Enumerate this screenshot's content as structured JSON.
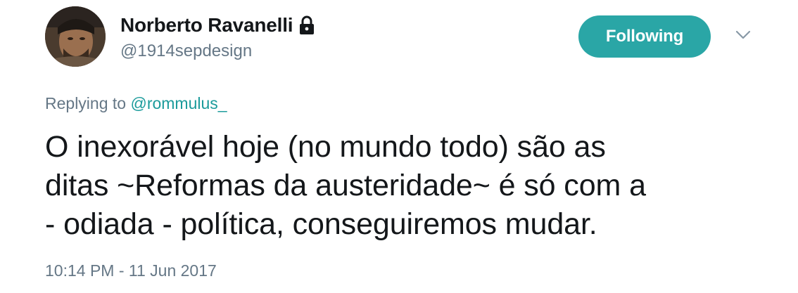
{
  "author": {
    "display_name": "Norberto Ravanelli",
    "handle": "@1914sepdesign",
    "protected_icon": "lock-icon",
    "avatar_icon": "avatar-photo"
  },
  "actions": {
    "follow_label": "Following",
    "more_icon": "chevron-down-icon"
  },
  "reply": {
    "prefix": "Replying to",
    "mention": "@rommulus_"
  },
  "tweet": {
    "line1": "O inexorável hoje (no mundo todo) são as",
    "line2": "ditas ~Reformas da austeridade~ é só com a",
    "line3": "- odiada - política, conseguiremos mudar."
  },
  "timestamp": "10:14 PM - 11 Jun 2017",
  "colors": {
    "accent": "#2aa6a6",
    "secondary_text": "#657786",
    "primary_text": "#14171a"
  }
}
